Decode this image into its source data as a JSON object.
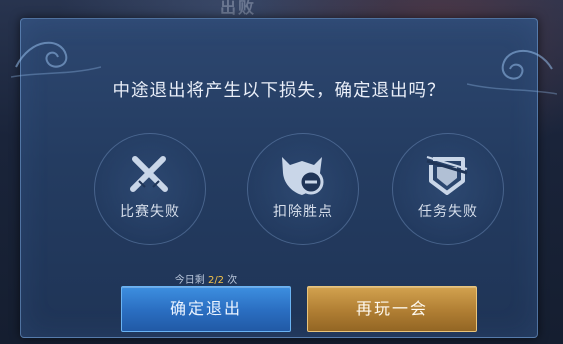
{
  "background": {
    "title": "出败"
  },
  "dialog": {
    "question": "中途退出将产生以下损失，确定退出吗？",
    "losses": [
      {
        "label": "比赛失败",
        "icon": "crossed-swords-icon"
      },
      {
        "label": "扣除胜点",
        "icon": "minus-badge-icon"
      },
      {
        "label": "任务失败",
        "icon": "broken-shield-icon"
      }
    ],
    "remaining": {
      "prefix": "今日剩",
      "count": "2/2",
      "suffix": "次"
    },
    "buttons": {
      "confirm": "确定退出",
      "continue": "再玩一会"
    }
  },
  "colors": {
    "accent_confirm": "#2a6dc0",
    "accent_continue": "#b07e33",
    "count_highlight": "#f0c04a"
  }
}
